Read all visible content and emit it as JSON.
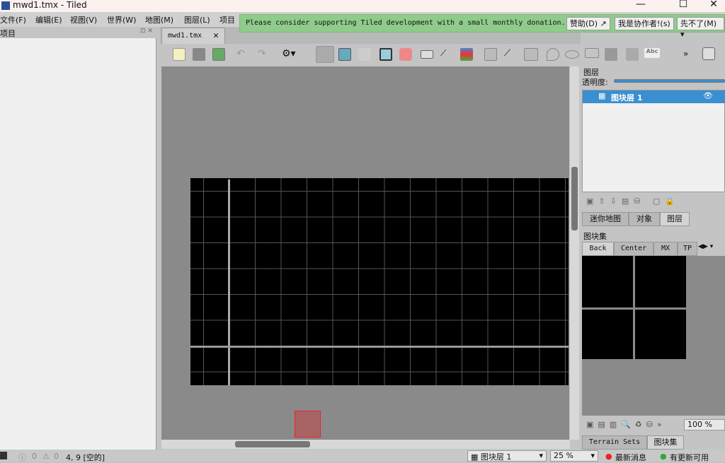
{
  "window": {
    "title": "mwd1.tmx - Tiled",
    "minimize": "—",
    "maximize": "☐",
    "close": "✕"
  },
  "menu": [
    "文件(F)",
    "编辑(E)",
    "视图(V)",
    "世界(W)",
    "地图(M)",
    "图层(L)",
    "项目"
  ],
  "notice": {
    "message": "Please consider supporting Tiled development with a small monthly donation.",
    "donate": "赞助(D) ↗",
    "contributor": "我是协作者!(s)",
    "later": "先不了(M) ▾",
    "color": "#8fcb8a"
  },
  "left_panel": {
    "title": "项目"
  },
  "doc_tab": {
    "label": "mwd1.tmx",
    "close": "✕"
  },
  "toolbar": {
    "overflow": "»"
  },
  "right": {
    "layers_title": "图层",
    "opacity_label": "透明度:",
    "opacity": 1.0,
    "layers": [
      {
        "name": "图块层 1",
        "selected": true,
        "visible": true
      }
    ],
    "tabs": [
      "迷你地图",
      "对象",
      "图层"
    ],
    "active_tab": "图层",
    "tilesets_title": "图块集",
    "tileset_tabs": [
      "Back",
      "Center",
      "MX",
      "TP"
    ],
    "zoom": "100 %",
    "bottom_tabs": [
      "Terrain Sets",
      "图块集"
    ]
  },
  "status": {
    "errors": "0",
    "warnings": "0",
    "position": "4, 9 [空的]",
    "layer": "图块层 1",
    "zoom": "25 %",
    "news": "最新消息",
    "update": "有更新可用"
  },
  "colors": {
    "selection": "#3a8fd0",
    "map_bg": "#000000",
    "canvas_bg": "#8a8a8a"
  }
}
